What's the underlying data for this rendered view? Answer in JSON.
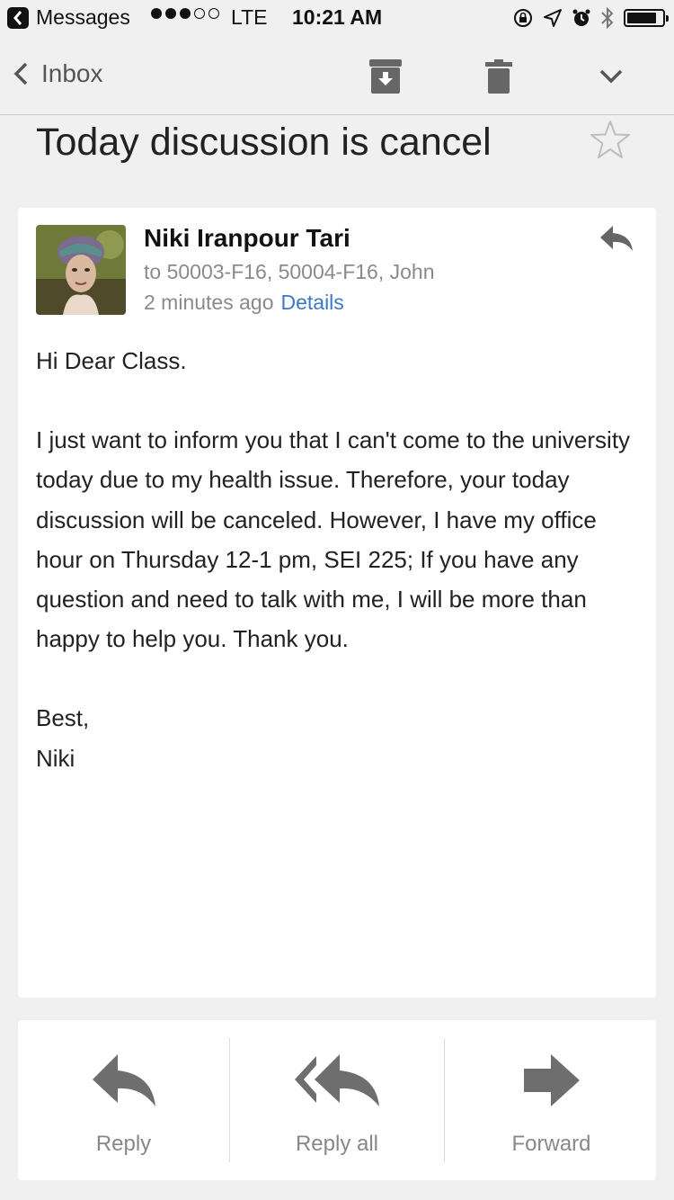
{
  "status_bar": {
    "back_app": "Messages",
    "signal_bars_filled": 3,
    "signal_bars_total": 5,
    "network": "LTE",
    "time": "10:21 AM",
    "icons": [
      "rotation-lock-icon",
      "location-icon",
      "alarm-icon",
      "bluetooth-icon",
      "battery-icon"
    ],
    "battery_level": 0.85
  },
  "nav": {
    "back_label": "Inbox",
    "icons": [
      "archive-icon",
      "trash-icon",
      "chevron-down-icon"
    ]
  },
  "email": {
    "subject": "Today discussion is cancel",
    "sender_name": "Niki Iranpour Tari",
    "recipients": "to 50003-F16, 50004-F16, John",
    "timestamp": "2 minutes ago",
    "details_label": "Details",
    "greeting": "Hi Dear Class.",
    "body": "I just want to inform you that I can't come to the university today due to my health issue. Therefore, your today discussion will be canceled. However, I have my office hour on Thursday 12-1 pm, SEI 225; If you have any question and need to talk with me, I will be more than happy to help you. Thank you.",
    "signoff": "Best,",
    "signature": "Niki"
  },
  "actions": {
    "reply": "Reply",
    "reply_all": "Reply all",
    "forward": "Forward"
  },
  "colors": {
    "background": "#f0f0f0",
    "card": "#ffffff",
    "link": "#3b78c8",
    "icon_gray": "#6e6e6e",
    "muted_text": "#8a8a8a"
  }
}
